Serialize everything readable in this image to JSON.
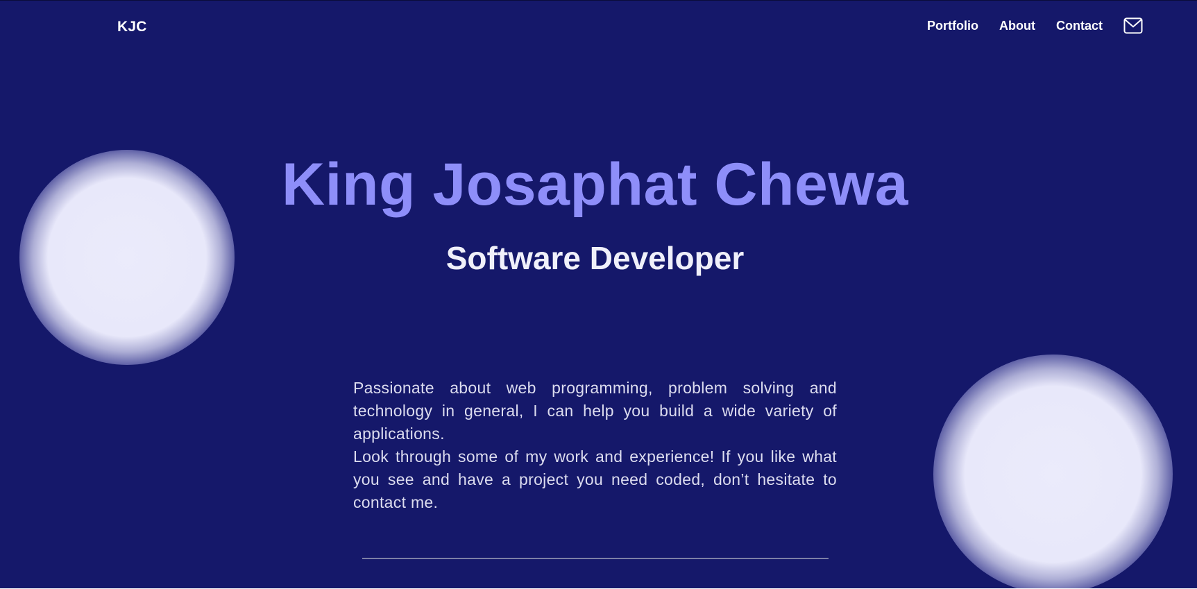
{
  "nav": {
    "logo": "KJC",
    "links": [
      "Portfolio",
      "About",
      "Contact"
    ],
    "mail_icon": "mail-icon"
  },
  "hero": {
    "name": "King Josaphat Chewa",
    "role": "Software Developer"
  },
  "intro": {
    "paragraph_1": "Passionate about web programming, problem solving and technology in general, I can help you build a wide variety of applications.",
    "paragraph_2": "Look through some of my work and experience! If you like what you see and have a project you need coded, don’t hesitate to contact me."
  },
  "colors": {
    "background": "#15186a",
    "accent": "#8e8ef9",
    "text": "#ffffff"
  }
}
